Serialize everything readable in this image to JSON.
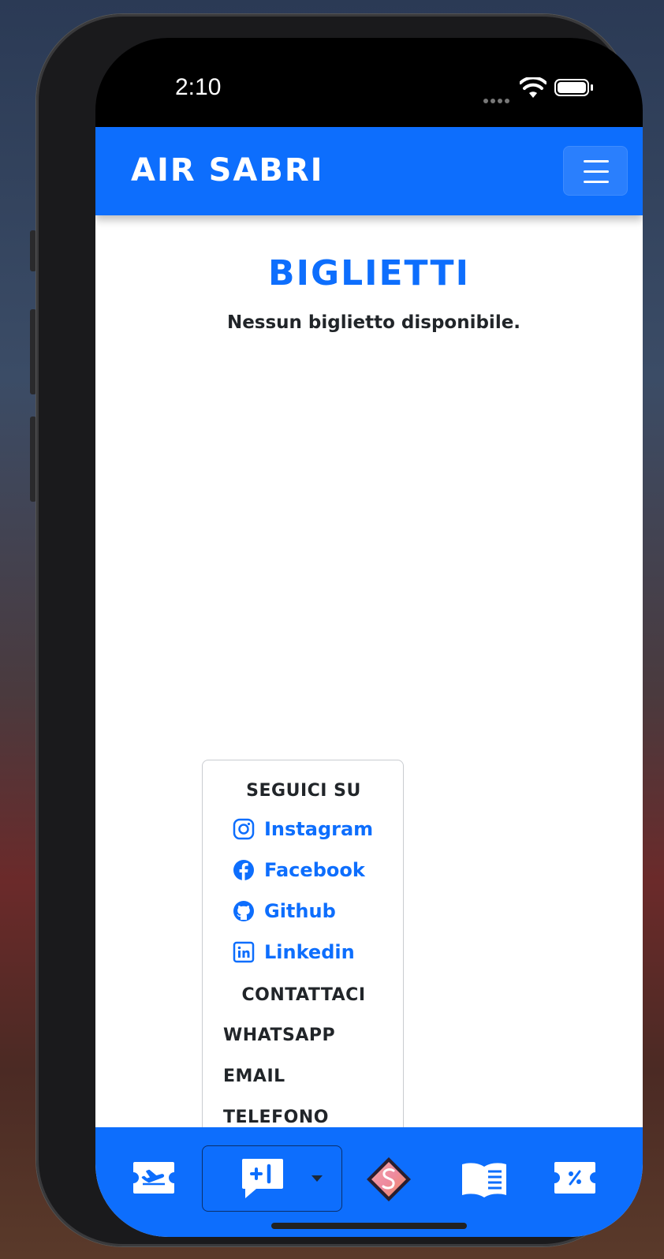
{
  "status_bar": {
    "time": "2:10"
  },
  "navbar": {
    "brand": "AIR SABRI"
  },
  "main": {
    "title": "BIGLIETTI",
    "empty_message": "Nessun biglietto disponibile."
  },
  "dropdown": {
    "follow_header": "SEGUICI SU",
    "social_links": [
      {
        "label": "Instagram",
        "icon": "instagram-icon"
      },
      {
        "label": "Facebook",
        "icon": "facebook-icon"
      },
      {
        "label": "Github",
        "icon": "github-icon"
      },
      {
        "label": "Linkedin",
        "icon": "linkedin-icon"
      }
    ],
    "contact_header": "CONTATTACI",
    "contact_items": [
      "WHATSAPP",
      "EMAIL",
      "TELEFONO"
    ]
  },
  "bottom_bar": {
    "items": [
      {
        "icon": "flight-ticket-icon"
      },
      {
        "icon": "add-comment-icon",
        "has_dropdown": true
      },
      {
        "icon": "sabri-logo-icon"
      },
      {
        "icon": "book-icon"
      },
      {
        "icon": "discount-ticket-icon"
      }
    ]
  },
  "colors": {
    "primary": "#0d6efd",
    "text": "#212529"
  }
}
